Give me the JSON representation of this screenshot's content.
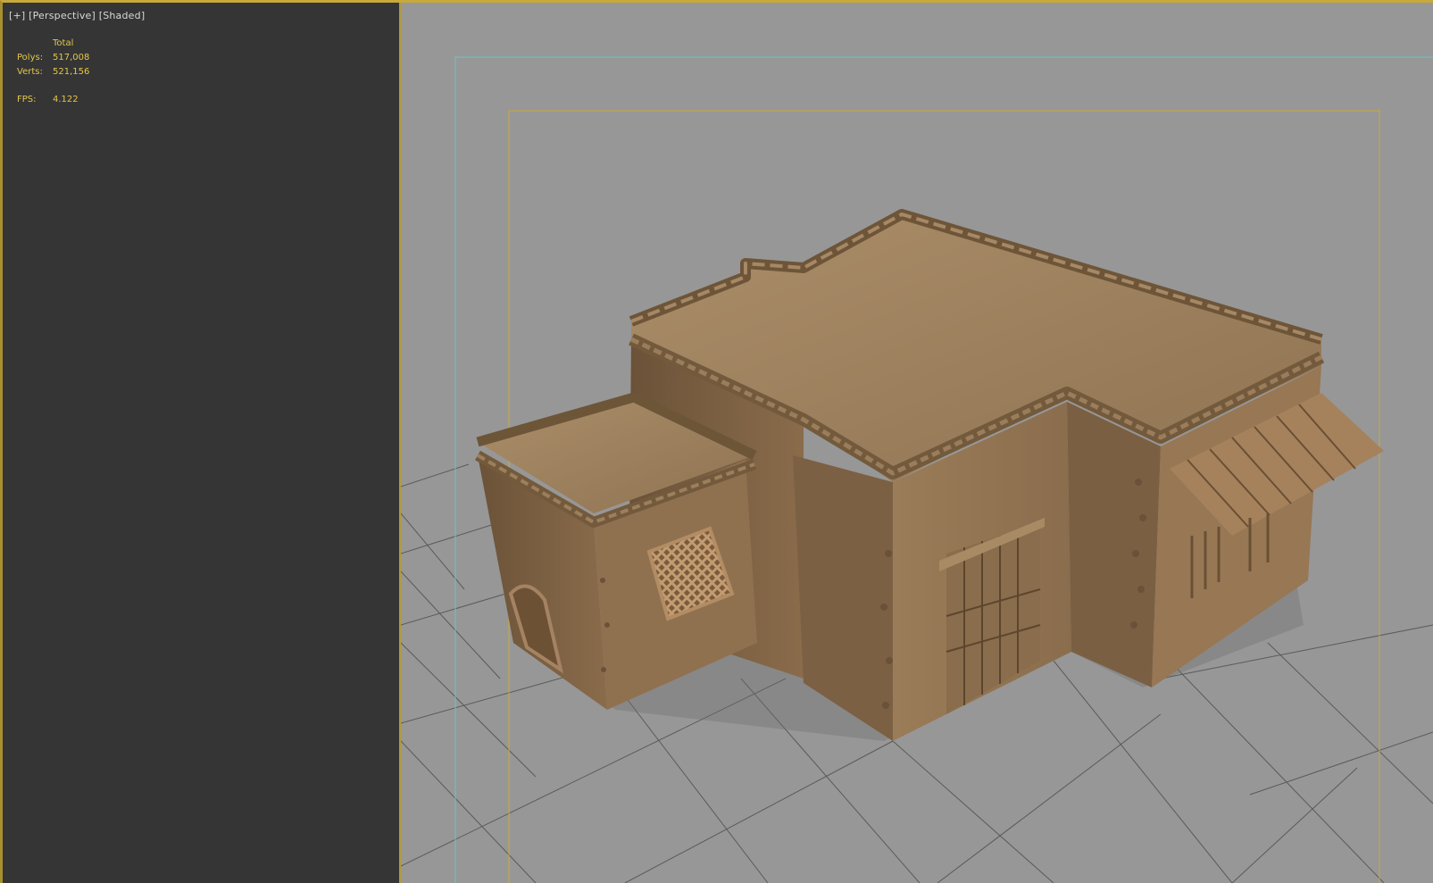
{
  "viewport": {
    "label_plus": "[+]",
    "label_view": "[Perspective]",
    "label_shading": "[Shaded]"
  },
  "stats": {
    "header": "Total",
    "polys_label": "Polys:",
    "polys_value": "517,008",
    "verts_label": "Verts:",
    "verts_value": "521,156",
    "fps_label": "FPS:",
    "fps_value": "4.122"
  },
  "colors": {
    "panel_bg": "#353535",
    "viewport_bg": "#979797",
    "active_border": "#c8a93b",
    "stats_text": "#e3c64a",
    "safe_frame_outer": "#6fc3c3",
    "safe_frame_inner": "#c9a93f",
    "grid_line": "#5c5c5c",
    "clay": "#a78762"
  },
  "icons": {
    "model": "mud-brick-house-model"
  }
}
